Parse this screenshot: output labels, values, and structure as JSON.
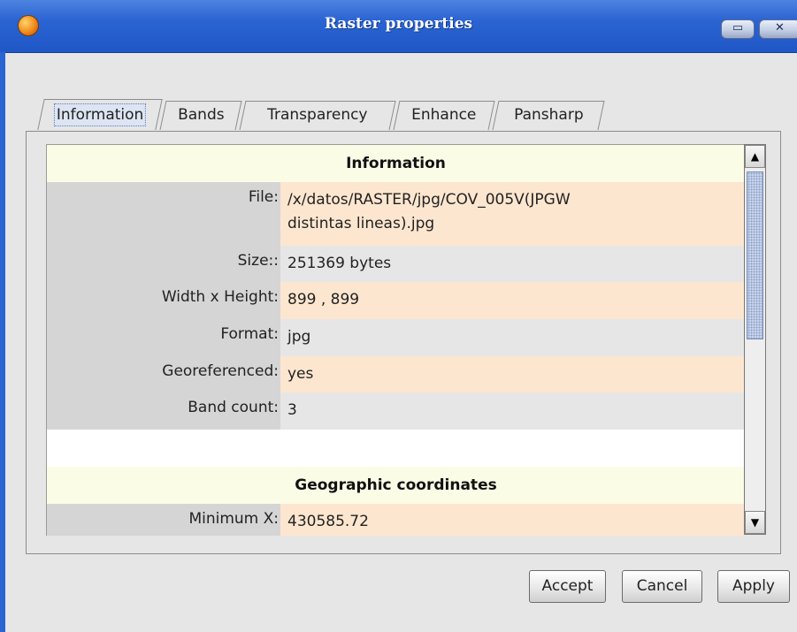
{
  "window": {
    "title": "Raster properties"
  },
  "tabs": [
    {
      "label": "Information"
    },
    {
      "label": "Bands"
    },
    {
      "label": "Transparency"
    },
    {
      "label": "Enhance"
    },
    {
      "label": "Pansharp"
    }
  ],
  "active_tab": "Information",
  "info_section": {
    "title": "Information",
    "rows": [
      {
        "label": "File:",
        "value_line1": "/x/datos/RASTER/jpg/COV_005V(JPGW",
        "value_line2": "distintas lineas).jpg"
      },
      {
        "label": "Size::",
        "value": "251369 bytes"
      },
      {
        "label": "Width x Height:",
        "value": "899 , 899"
      },
      {
        "label": "Format:",
        "value": "jpg"
      },
      {
        "label": "Georeferenced:",
        "value": "yes"
      },
      {
        "label": "Band count:",
        "value": "3"
      }
    ]
  },
  "geo_section": {
    "title": "Geographic coordinates",
    "rows": [
      {
        "label": "Minimum X:",
        "value": "430585.72"
      }
    ]
  },
  "buttons": {
    "accept": "Accept",
    "cancel": "Cancel",
    "apply": "Apply"
  },
  "icons": {
    "app": "gvsig-app-icon",
    "minimize": "minimize-icon",
    "close": "close-icon",
    "scroll_up": "scroll-up-arrow-icon",
    "scroll_down": "scroll-down-arrow-icon"
  }
}
